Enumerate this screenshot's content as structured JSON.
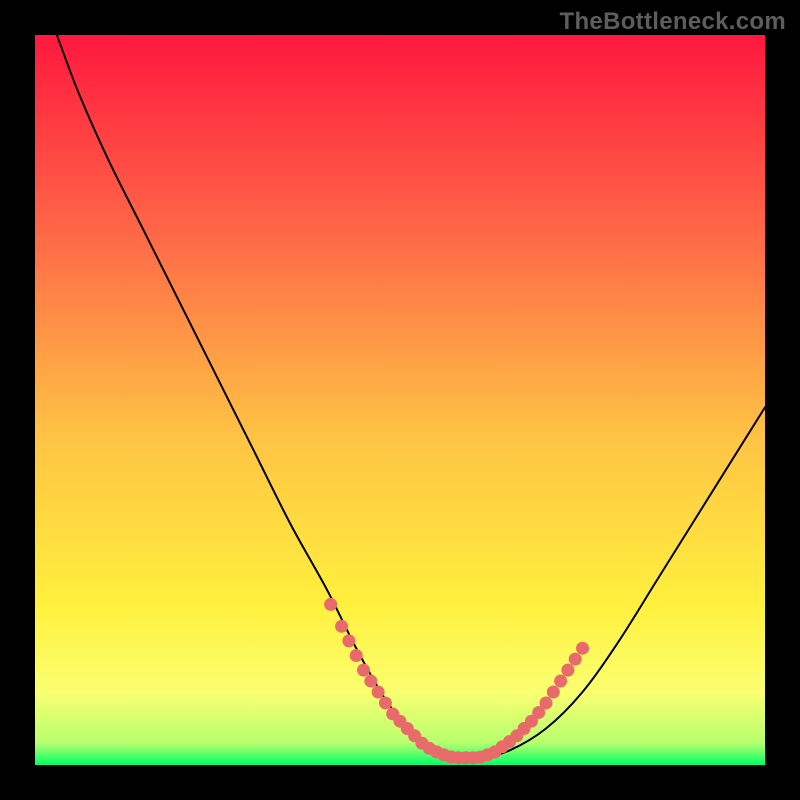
{
  "watermark": "TheBottleneck.com",
  "colors": {
    "frame": "#000000",
    "gradient_top": "#ff183e",
    "gradient_mid_upper": "#ff7a4a",
    "gradient_mid": "#ffc344",
    "gradient_mid_lower": "#fff03d",
    "gradient_low": "#faff70",
    "gradient_bottom": "#00ff66",
    "curve": "#000000",
    "marker": "#e86a6a"
  },
  "chart_data": {
    "type": "line",
    "title": "",
    "xlabel": "",
    "ylabel": "",
    "xlim": [
      0,
      100
    ],
    "ylim": [
      0,
      100
    ],
    "series": [
      {
        "name": "bottleneck-curve",
        "x": [
          3,
          6,
          10,
          15,
          20,
          25,
          30,
          35,
          40,
          44,
          48,
          52,
          55,
          58,
          61,
          65,
          70,
          75,
          80,
          85,
          90,
          95,
          100
        ],
        "y": [
          100,
          92,
          83,
          73,
          63,
          53,
          43,
          33,
          24,
          16,
          9,
          4,
          2,
          1,
          1,
          2,
          5,
          10,
          17,
          25,
          33,
          41,
          49
        ]
      }
    ],
    "markers": [
      {
        "x": 40.5,
        "y": 22
      },
      {
        "x": 42.0,
        "y": 19
      },
      {
        "x": 43.0,
        "y": 17
      },
      {
        "x": 44.0,
        "y": 15
      },
      {
        "x": 45.0,
        "y": 13
      },
      {
        "x": 46.0,
        "y": 11.5
      },
      {
        "x": 47.0,
        "y": 10
      },
      {
        "x": 48.0,
        "y": 8.5
      },
      {
        "x": 49.0,
        "y": 7
      },
      {
        "x": 50.0,
        "y": 6
      },
      {
        "x": 51.0,
        "y": 5
      },
      {
        "x": 52.0,
        "y": 4
      },
      {
        "x": 53.0,
        "y": 3
      },
      {
        "x": 54.0,
        "y": 2.3
      },
      {
        "x": 55.0,
        "y": 1.8
      },
      {
        "x": 56.0,
        "y": 1.4
      },
      {
        "x": 57.0,
        "y": 1.1
      },
      {
        "x": 58.0,
        "y": 1.0
      },
      {
        "x": 59.0,
        "y": 1.0
      },
      {
        "x": 60.0,
        "y": 1.0
      },
      {
        "x": 61.0,
        "y": 1.1
      },
      {
        "x": 62.0,
        "y": 1.4
      },
      {
        "x": 63.0,
        "y": 1.8
      },
      {
        "x": 64.0,
        "y": 2.5
      },
      {
        "x": 65.0,
        "y": 3.2
      },
      {
        "x": 66.0,
        "y": 4
      },
      {
        "x": 67.0,
        "y": 5
      },
      {
        "x": 68.0,
        "y": 6
      },
      {
        "x": 69.0,
        "y": 7.2
      },
      {
        "x": 70.0,
        "y": 8.5
      },
      {
        "x": 71.0,
        "y": 10
      },
      {
        "x": 72.0,
        "y": 11.5
      },
      {
        "x": 73.0,
        "y": 13
      },
      {
        "x": 74.0,
        "y": 14.5
      },
      {
        "x": 75.0,
        "y": 16
      }
    ]
  }
}
